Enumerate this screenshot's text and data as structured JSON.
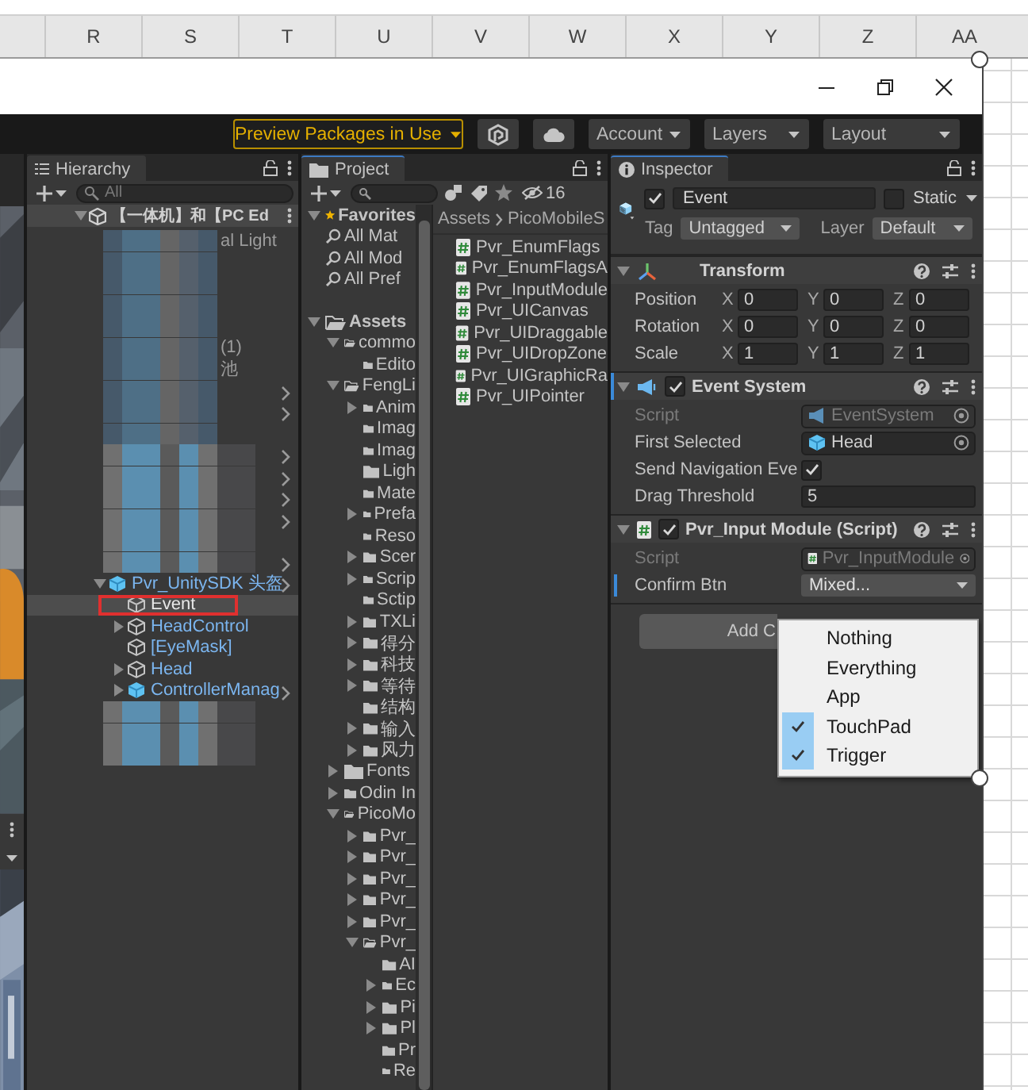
{
  "sheet": {
    "columns": [
      "R",
      "S",
      "T",
      "U",
      "V",
      "W",
      "X",
      "Y",
      "Z",
      "AA"
    ]
  },
  "toolbar": {
    "preview_button": "Preview Packages in Use",
    "menus": [
      "Account",
      "Layers",
      "Layout"
    ]
  },
  "hierarchy": {
    "tab": "Hierarchy",
    "search_placeholder": "All",
    "scene": {
      "label": "【一体机】和【PC Ed",
      "expanded": true,
      "children": [
        {
          "kind": "blurred",
          "text": "al Light",
          "chevron": false
        },
        {
          "kind": "blurred",
          "chevron": false
        },
        {
          "kind": "blurred",
          "chevron": false
        },
        {
          "kind": "blurred",
          "chevron": false
        },
        {
          "kind": "blurred",
          "chevron": false
        },
        {
          "kind": "blurred",
          "text": "(1)",
          "chevron": false
        },
        {
          "kind": "blurred",
          "text": "池",
          "chevron": false
        },
        {
          "kind": "blurred",
          "chevron": true
        },
        {
          "kind": "blurred",
          "chevron": true
        },
        {
          "kind": "blurred",
          "chevron": false
        },
        {
          "kind": "blurred",
          "chevron": true
        },
        {
          "kind": "blurred",
          "chevron": true
        },
        {
          "kind": "blurred",
          "chevron": true
        },
        {
          "kind": "blurred",
          "chevron": true
        },
        {
          "kind": "blurred",
          "chevron": false
        },
        {
          "kind": "blurred",
          "chevron": true
        },
        {
          "kind": "prefab-root",
          "label": "Pvr_UnitySDK 头盔",
          "expanded": true,
          "selected": false,
          "boxed": false,
          "children": [
            {
              "kind": "object",
              "label": "Event",
              "selected": true,
              "boxed": true
            },
            {
              "kind": "prefab",
              "label": "HeadControl",
              "expanded": false,
              "selected": false,
              "boxed": false
            },
            {
              "kind": "prefab",
              "label": "[EyeMask]",
              "selected": false,
              "boxed": false
            },
            {
              "kind": "prefab",
              "label": "Head",
              "expanded": false,
              "selected": false,
              "boxed": false
            },
            {
              "kind": "prefab-root",
              "label": "ControllerManag",
              "expanded": false,
              "selected": false,
              "boxed": false
            }
          ]
        },
        {
          "kind": "blurred",
          "chevron": false
        },
        {
          "kind": "blurred",
          "chevron": false
        },
        {
          "kind": "blurred",
          "chevron": false
        }
      ]
    }
  },
  "project": {
    "tab": "Project",
    "hidden_count": "16",
    "tree": [
      {
        "kind": "favorites",
        "label": "Favorites",
        "expanded": true,
        "children": [
          {
            "kind": "search",
            "label": "All Mat"
          },
          {
            "kind": "search",
            "label": "All Mod"
          },
          {
            "kind": "search",
            "label": "All Pref"
          }
        ]
      },
      {
        "kind": "folder",
        "label": "Assets",
        "expanded": true,
        "children": [
          {
            "kind": "folder",
            "label": "commo",
            "expanded": true,
            "children": [
              {
                "kind": "folder",
                "label": "Edito"
              }
            ]
          },
          {
            "kind": "folder",
            "label": "FengLi",
            "expanded": true,
            "children": [
              {
                "kind": "folder",
                "label": "Anim",
                "expanded": false
              },
              {
                "kind": "folder",
                "label": "Imag"
              },
              {
                "kind": "folder",
                "label": "Imag"
              },
              {
                "kind": "folder",
                "label": "Ligh"
              },
              {
                "kind": "folder",
                "label": "Mate"
              },
              {
                "kind": "folder",
                "label": "Prefa",
                "expanded": false
              },
              {
                "kind": "folder",
                "label": "Reso"
              },
              {
                "kind": "folder",
                "label": "Scer",
                "expanded": false
              },
              {
                "kind": "folder",
                "label": "Scrip",
                "expanded": false
              },
              {
                "kind": "folder",
                "label": "Sctip"
              },
              {
                "kind": "folder",
                "label": "TXLi",
                "expanded": false
              },
              {
                "kind": "folder",
                "label": "得分",
                "expanded": false
              },
              {
                "kind": "folder",
                "label": "科技",
                "expanded": false
              },
              {
                "kind": "folder",
                "label": "等待",
                "expanded": false
              },
              {
                "kind": "folder",
                "label": "结构"
              },
              {
                "kind": "folder",
                "label": "输入",
                "expanded": false
              },
              {
                "kind": "folder",
                "label": "风力",
                "expanded": false
              }
            ]
          },
          {
            "kind": "folder",
            "label": "Fonts",
            "expanded": false
          },
          {
            "kind": "folder",
            "label": "Odin In",
            "expanded": false
          },
          {
            "kind": "folder",
            "label": "PicoMo",
            "expanded": true,
            "children": [
              {
                "kind": "folder",
                "label": "Pvr_",
                "expanded": false
              },
              {
                "kind": "folder",
                "label": "Pvr_",
                "expanded": false
              },
              {
                "kind": "folder",
                "label": "Pvr_",
                "expanded": false
              },
              {
                "kind": "folder",
                "label": "Pvr_",
                "expanded": false
              },
              {
                "kind": "folder",
                "label": "Pvr_",
                "expanded": false
              },
              {
                "kind": "folder",
                "label": "Pvr_",
                "expanded": true,
                "children": [
                  {
                    "kind": "folder",
                    "label": "AI"
                  },
                  {
                    "kind": "folder",
                    "label": "Ec",
                    "expanded": false
                  },
                  {
                    "kind": "folder",
                    "label": "Pi",
                    "expanded": false
                  },
                  {
                    "kind": "folder",
                    "label": "Pl",
                    "expanded": false
                  },
                  {
                    "kind": "folder",
                    "label": "Pr"
                  },
                  {
                    "kind": "folder",
                    "label": "Re"
                  }
                ]
              }
            ]
          }
        ]
      }
    ],
    "breadcrumb": [
      "Assets",
      "PicoMobileS"
    ],
    "files": [
      "Pvr_EnumFlags",
      "Pvr_EnumFlagsA",
      "Pvr_InputModule",
      "Pvr_UICanvas",
      "Pvr_UIDraggable",
      "Pvr_UIDropZone",
      "Pvr_UIGraphicRa",
      "Pvr_UIPointer"
    ]
  },
  "inspector": {
    "tab": "Inspector",
    "object": {
      "enabled": true,
      "name": "Event",
      "static_checked": false,
      "static_label": "Static",
      "tag_label": "Tag",
      "tag": "Untagged",
      "layer_label": "Layer",
      "layer": "Default"
    },
    "components": [
      {
        "kind": "transform",
        "title": "Transform",
        "marked": false,
        "rows": [
          {
            "label": "Position",
            "values": [
              {
                "axis": "X",
                "value": "0"
              },
              {
                "axis": "Y",
                "value": "0"
              },
              {
                "axis": "Z",
                "value": "0"
              }
            ]
          },
          {
            "label": "Rotation",
            "values": [
              {
                "axis": "X",
                "value": "0"
              },
              {
                "axis": "Y",
                "value": "0"
              },
              {
                "axis": "Z",
                "value": "0"
              }
            ]
          },
          {
            "label": "Scale",
            "values": [
              {
                "axis": "X",
                "value": "1"
              },
              {
                "axis": "Y",
                "value": "1"
              },
              {
                "axis": "Z",
                "value": "1"
              }
            ]
          }
        ]
      },
      {
        "kind": "event-system",
        "title": "Event System",
        "enabled": true,
        "marked": true,
        "properties": [
          {
            "kind": "object",
            "label": "Script",
            "value": "EventSystem",
            "disabled": true,
            "marked": false
          },
          {
            "kind": "object",
            "label": "First Selected",
            "value": "Head",
            "disabled": false,
            "marked": false
          },
          {
            "kind": "toggle",
            "label": "Send Navigation Eve",
            "checked": true,
            "disabled": false,
            "marked": false
          },
          {
            "kind": "text",
            "label": "Drag Threshold",
            "value": "5",
            "disabled": false,
            "marked": false
          }
        ]
      },
      {
        "kind": "script",
        "title": "Pvr_Input Module (Script)",
        "enabled": true,
        "marked": false,
        "properties": [
          {
            "kind": "script-ref",
            "label": "Script",
            "value": "Pvr_InputModule",
            "disabled": true,
            "marked": false
          },
          {
            "kind": "dropdown",
            "label": "Confirm Btn",
            "value": "Mixed...",
            "disabled": false,
            "marked": true
          }
        ]
      }
    ],
    "add_button": "Add C",
    "menu": {
      "items": [
        {
          "label": "Nothing",
          "checked": false
        },
        {
          "label": "Everything",
          "checked": false
        },
        {
          "label": "App",
          "checked": false
        },
        {
          "label": "TouchPad",
          "checked": true
        },
        {
          "label": "Trigger",
          "checked": true
        }
      ]
    }
  }
}
